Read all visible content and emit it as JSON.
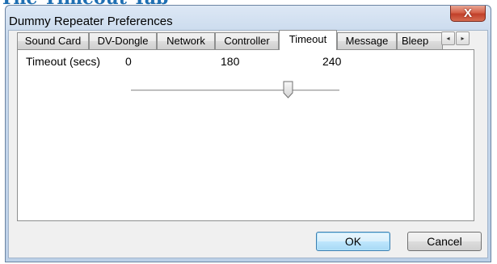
{
  "page_heading": "The Timeout Tab",
  "window": {
    "title": "Dummy Repeater Preferences",
    "close_glyph": "X"
  },
  "tabs": [
    {
      "label": "Sound Card"
    },
    {
      "label": "DV-Dongle"
    },
    {
      "label": "Network"
    },
    {
      "label": "Controller"
    },
    {
      "label": "Timeout"
    },
    {
      "label": "Message"
    },
    {
      "label": "Bleep"
    }
  ],
  "active_tab": "Timeout",
  "tab_scroll": {
    "left_glyph": "◂",
    "right_glyph": "▸"
  },
  "timeout": {
    "label": "Timeout (secs)",
    "min_label": "0",
    "value_label": "180",
    "max_label": "240",
    "slider": {
      "min": 0,
      "max": 240,
      "value": 180
    }
  },
  "buttons": {
    "ok": "OK",
    "cancel": "Cancel"
  },
  "colors": {
    "heading": "#1f6fb2",
    "close_button": "#c1402a",
    "default_button_border": "#3c7fb1"
  }
}
